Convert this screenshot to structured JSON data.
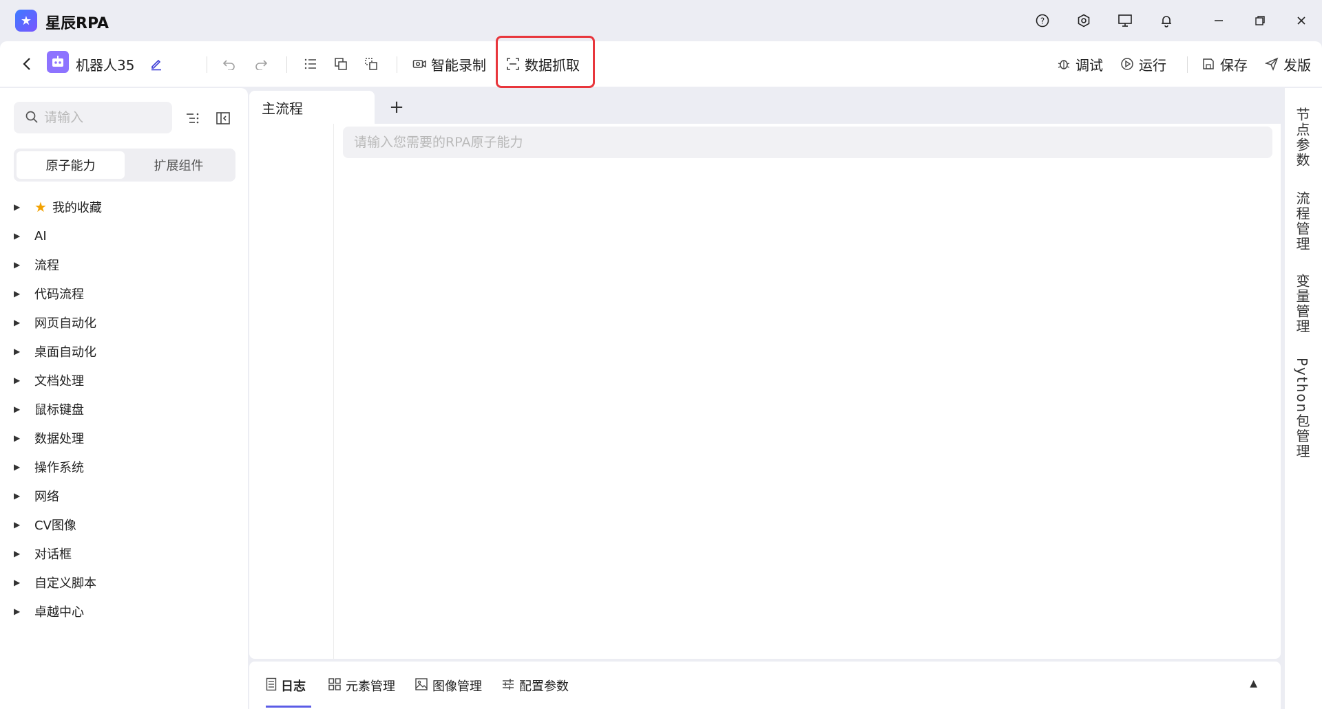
{
  "titlebar": {
    "app_title": "星辰RPA",
    "icons": [
      "help-icon",
      "settings-icon",
      "monitor-icon",
      "bell-icon",
      "minimize-icon",
      "restore-icon",
      "close-icon"
    ]
  },
  "toolbar": {
    "robot_name": "机器人35",
    "smart_record": "智能录制",
    "data_capture": "数据抓取",
    "debug": "调试",
    "run": "运行",
    "save": "保存",
    "publish": "发版"
  },
  "left_panel": {
    "search_placeholder": "请输入",
    "segments": [
      "原子能力",
      "扩展组件"
    ],
    "active_segment": "原子能力",
    "tree": [
      {
        "label": "我的收藏",
        "starred": true
      },
      {
        "label": "AI"
      },
      {
        "label": "流程"
      },
      {
        "label": "代码流程"
      },
      {
        "label": "网页自动化"
      },
      {
        "label": "桌面自动化"
      },
      {
        "label": "文档处理"
      },
      {
        "label": "鼠标键盘"
      },
      {
        "label": "数据处理"
      },
      {
        "label": "操作系统"
      },
      {
        "label": "网络"
      },
      {
        "label": "CV图像"
      },
      {
        "label": "对话框"
      },
      {
        "label": "自定义脚本"
      },
      {
        "label": "卓越中心"
      }
    ]
  },
  "main": {
    "tab_label": "主流程",
    "add_tab": "+",
    "rpa_input_placeholder": "请输入您需要的RPA原子能力"
  },
  "bottom_tabs": {
    "log": "日志",
    "elements": "元素管理",
    "images": "图像管理",
    "config": "配置参数"
  },
  "right_bar": {
    "node_params": "节点参数",
    "flow_mgmt": "流程管理",
    "var_mgmt": "变量管理",
    "python_pkg": "Python包管理"
  },
  "colors": {
    "accent": "#5b5ce6",
    "highlight_border": "#e8363c",
    "star": "#f2a100"
  }
}
